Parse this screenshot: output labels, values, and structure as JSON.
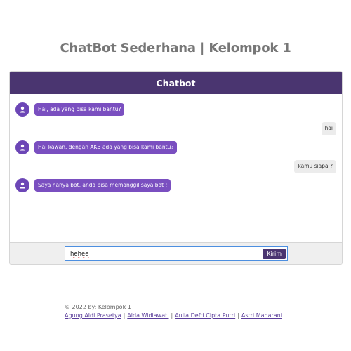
{
  "page": {
    "title": "ChatBot Sederhana | Kelompok 1"
  },
  "chat": {
    "header": "Chatbot",
    "messages": [
      {
        "from": "bot",
        "text": "Hai, ada yang bisa kami bantu?"
      },
      {
        "from": "user",
        "text": "hai"
      },
      {
        "from": "bot",
        "text": "Hai kawan. dengan AKB ada yang bisa kami bantu?"
      },
      {
        "from": "user",
        "text": "kamu siapa ?"
      },
      {
        "from": "bot",
        "text": "Saya hanya bot, anda bisa memanggil saya bot !"
      }
    ]
  },
  "input": {
    "value": "hehee",
    "send_label": "Kirim"
  },
  "footer": {
    "copyright": "© 2022 by: Kelompok 1",
    "members": [
      "Agung Aldi Prasetya",
      "Alda Widiawati",
      "Aulia Defti Cipta Putri",
      "Astri Maharani"
    ],
    "separator": "|"
  },
  "colors": {
    "header_bg": "#4a3570",
    "bot_bubble": "#7a4fc0",
    "user_bubble": "#ececec",
    "avatar": "#6c46b6"
  },
  "icons": {
    "bot_avatar": "user-avatar-icon"
  }
}
